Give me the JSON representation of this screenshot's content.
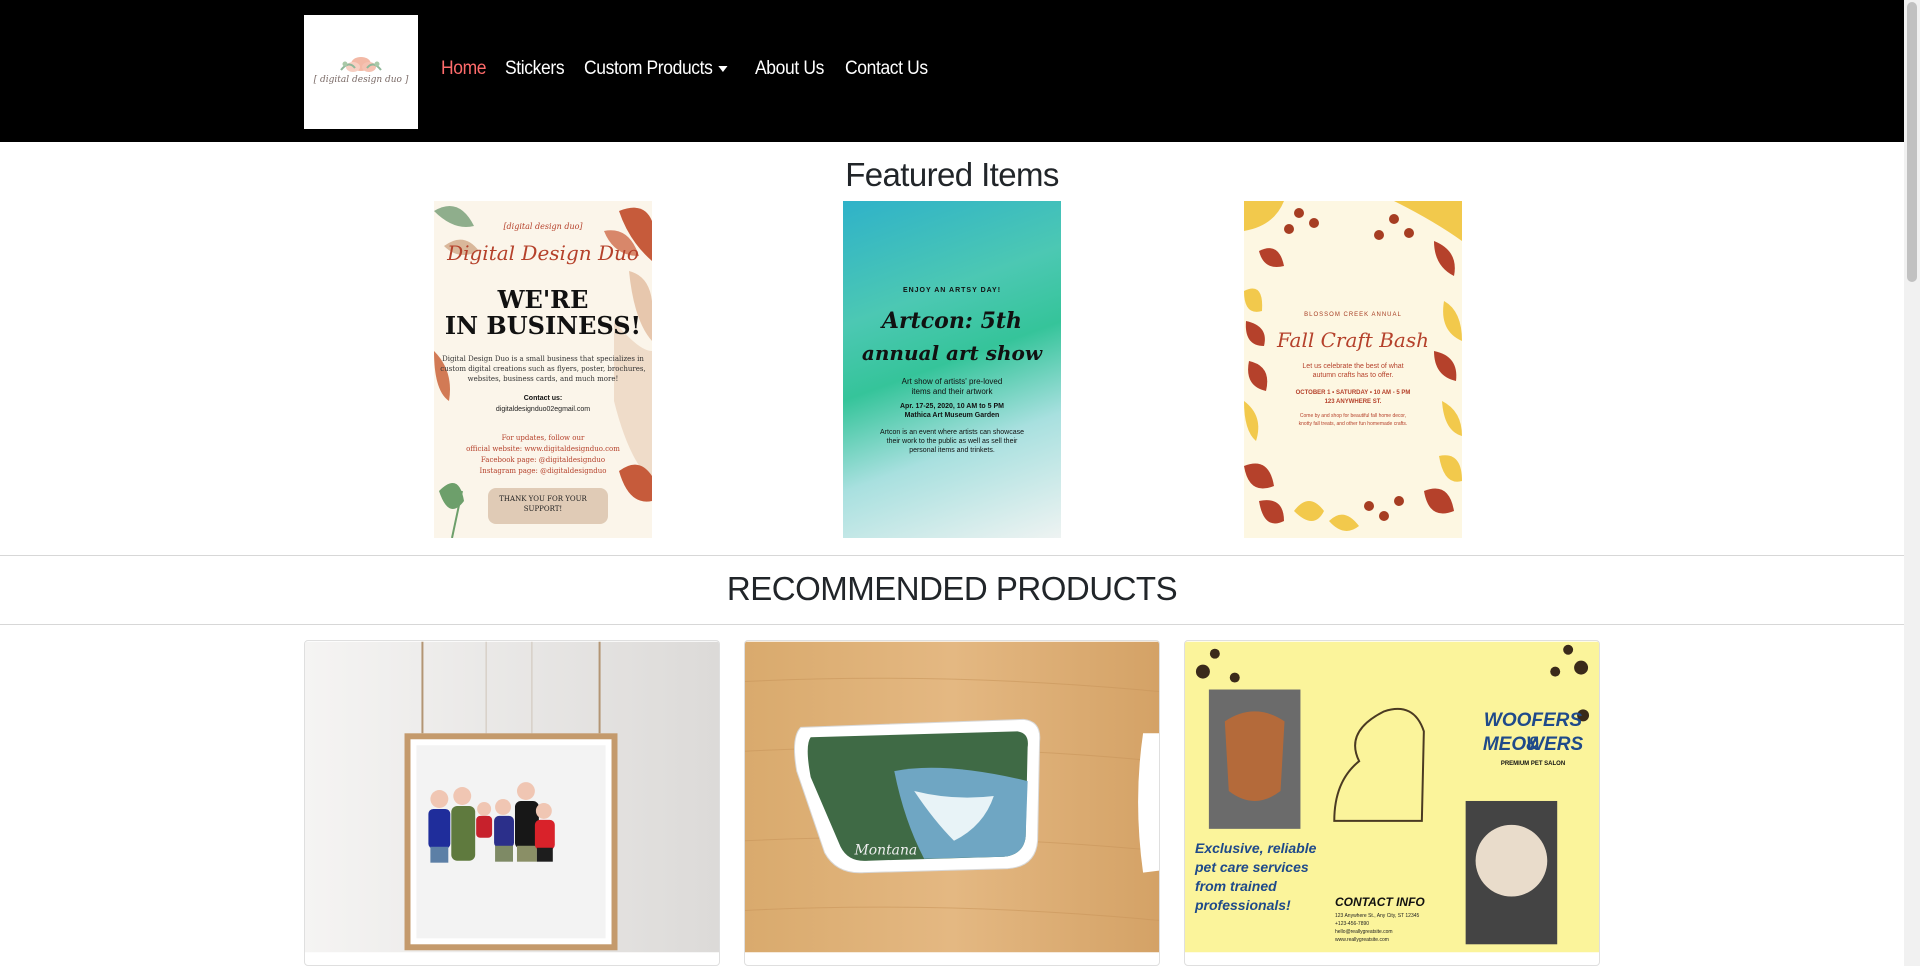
{
  "nav": {
    "logo_text": "[ digital design duo ]",
    "links": [
      {
        "label": "Home",
        "active": true
      },
      {
        "label": "Stickers",
        "active": false
      },
      {
        "label": "Custom Products",
        "active": false,
        "dropdown": true
      },
      {
        "label": "About Us",
        "active": false
      },
      {
        "label": "Contact Us",
        "active": false
      }
    ]
  },
  "featured": {
    "title": "Featured Items",
    "poster1": {
      "small": "[digital design duo]",
      "script": "Digital Design Duo",
      "headline1": "WE'RE",
      "headline2": "IN BUSINESS!",
      "body1": "Digital Design Duo is a small business that specializes in",
      "body2": "custom digital creations such as flyers, poster, brochures,",
      "body3": "websites, business cards, and much more!",
      "contact_label": "Contact us:",
      "contact": "digitaldesignduo02egmail.com",
      "updates1": "For updates, follow our",
      "updates2": "official website: www.digitaldesignduo.com",
      "updates3": "Facebook page: @digitaldesignduo",
      "updates4": "Instagram page: @digitaldesignduo",
      "thanks1": "THANK YOU FOR YOUR",
      "thanks2": "SUPPORT!"
    },
    "poster2": {
      "kicker": "ENJOY AN ARTSY DAY!",
      "title1": "Artcon: 5th",
      "title2": "annual art show",
      "sub1": "Art show of artists' pre-loved",
      "sub2": "items and their artwork",
      "date": "Apr. 17-25, 2020, 10 AM to 5 PM",
      "venue": "Mathica Art Museum Garden",
      "desc1": "Artcon is an event where artists can showcase",
      "desc2": "their work to the public as well as sell their",
      "desc3": "personal items and trinkets."
    },
    "poster3": {
      "kicker": "BLOSSOM CREEK ANNUAL",
      "title": "Fall Craft Bash",
      "sub1": "Let us celebrate the best of what",
      "sub2": "autumn crafts has to offer.",
      "date": "OCTOBER 1 • SATURDAY • 10 AM - 5 PM",
      "address": "123 ANYWHERE ST.",
      "desc1": "Come by and shop for beautiful fall home decor,",
      "desc2": "knotty fall treats, and other fun homemade crafts."
    }
  },
  "recommended": {
    "title": "RECOMMENDED PRODUCTS",
    "card2_caption": "Montana",
    "card3": {
      "title1": "WOOFERS &",
      "title2": "MEOWERS",
      "subtitle": "PREMIUM PET SALON",
      "tag1": "Exclusive, reliable",
      "tag2": "pet care services",
      "tag3": "from trained",
      "tag4": "professionals!",
      "contact": "CONTACT INFO",
      "addr1": "123 Anywhere St., Any City, ST 12345",
      "addr2": "+123-456-7890",
      "addr3": "hello@reallygreatsite.com",
      "addr4": "www.reallygreatsite.com"
    }
  },
  "colors": {
    "nav_bg": "#000000",
    "active_link": "#ff6b6b",
    "poster_red": "#b5412b"
  }
}
